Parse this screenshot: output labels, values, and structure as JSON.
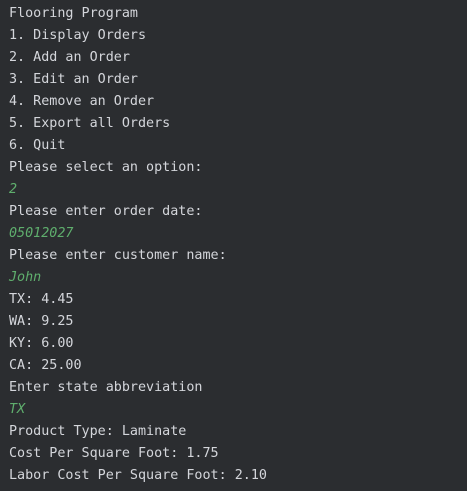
{
  "colors": {
    "background": "#2b2d30",
    "output_text": "#d4d6db",
    "user_input": "#5fae6d"
  },
  "console": {
    "lines": [
      {
        "text": "Flooring Program",
        "kind": "output"
      },
      {
        "text": "1. Display Orders",
        "kind": "output"
      },
      {
        "text": "2. Add an Order",
        "kind": "output"
      },
      {
        "text": "3. Edit an Order",
        "kind": "output"
      },
      {
        "text": "4. Remove an Order",
        "kind": "output"
      },
      {
        "text": "5. Export all Orders",
        "kind": "output"
      },
      {
        "text": "6. Quit",
        "kind": "output"
      },
      {
        "text": "Please select an option:",
        "kind": "output"
      },
      {
        "text": "2",
        "kind": "input"
      },
      {
        "text": "Please enter order date:",
        "kind": "output"
      },
      {
        "text": "05012027",
        "kind": "input"
      },
      {
        "text": "Please enter customer name:",
        "kind": "output"
      },
      {
        "text": "John",
        "kind": "input"
      },
      {
        "text": "TX: 4.45",
        "kind": "output"
      },
      {
        "text": "WA: 9.25",
        "kind": "output"
      },
      {
        "text": "KY: 6.00",
        "kind": "output"
      },
      {
        "text": "CA: 25.00",
        "kind": "output"
      },
      {
        "text": "Enter state abbreviation",
        "kind": "output"
      },
      {
        "text": "TX",
        "kind": "input"
      },
      {
        "text": "Product Type: Laminate",
        "kind": "output"
      },
      {
        "text": "Cost Per Square Foot: 1.75",
        "kind": "output"
      },
      {
        "text": "Labor Cost Per Square Foot: 2.10",
        "kind": "output"
      }
    ]
  }
}
